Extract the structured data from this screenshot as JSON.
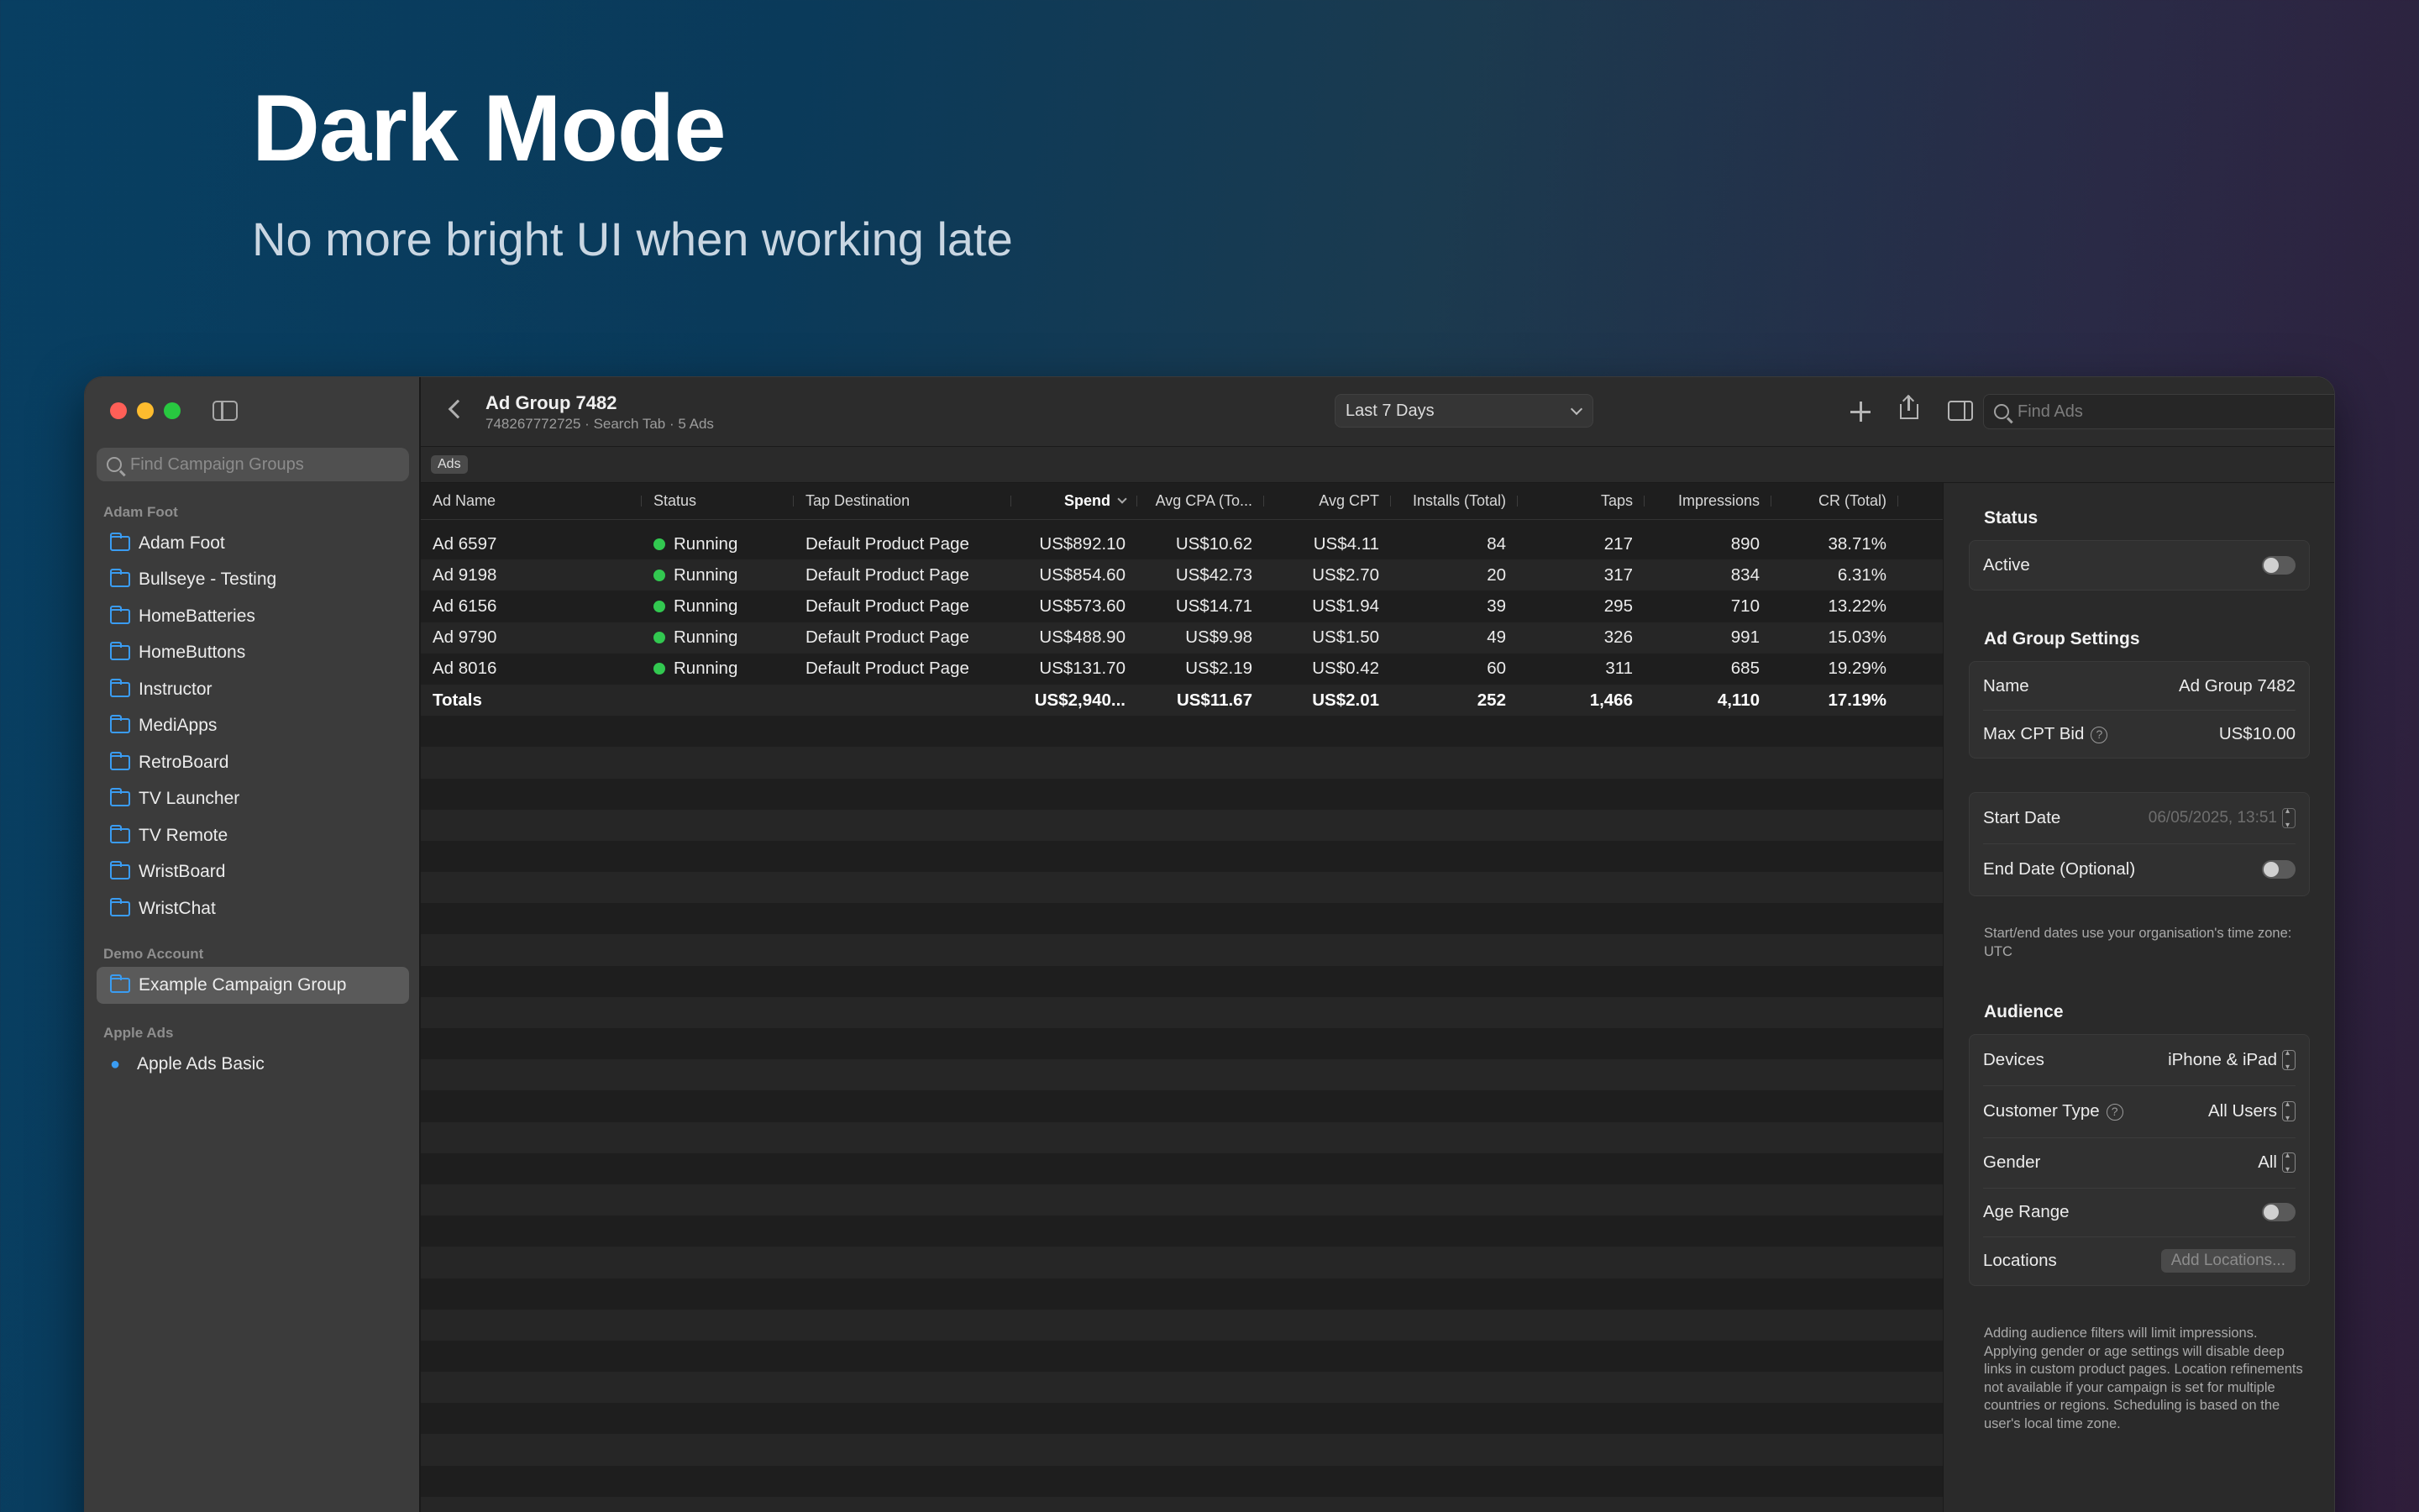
{
  "hero": {
    "title": "Dark Mode",
    "subtitle": "No more bright UI when working late"
  },
  "sidebar": {
    "search_placeholder": "Find Campaign Groups",
    "sections": [
      {
        "heading": "Adam Foot",
        "items": [
          "Adam Foot",
          "Bullseye - Testing",
          "HomeBatteries",
          "HomeButtons",
          "Instructor",
          "MediApps",
          "RetroBoard",
          "TV Launcher",
          "TV Remote",
          "WristBoard",
          "WristChat"
        ]
      },
      {
        "heading": "Demo Account",
        "items": [
          "Example Campaign Group"
        ]
      },
      {
        "heading": "Apple Ads",
        "items": [
          "Apple Ads Basic"
        ]
      }
    ]
  },
  "toolbar": {
    "title": "Ad Group 7482",
    "subtitle": "748267772725 · Search Tab · 5 Ads",
    "date_range": "Last 7 Days",
    "find_placeholder": "Find Ads",
    "tab_label": "Ads"
  },
  "table": {
    "columns": [
      "Ad Name",
      "Status",
      "Tap Destination",
      "Spend",
      "Avg CPA (To...",
      "Avg CPT",
      "Installs (Total)",
      "Taps",
      "Impressions",
      "CR (Total)"
    ],
    "rows": [
      [
        "Ad 6597",
        "Running",
        "Default Product Page",
        "US$892.10",
        "US$10.62",
        "US$4.11",
        "84",
        "217",
        "890",
        "38.71%"
      ],
      [
        "Ad 9198",
        "Running",
        "Default Product Page",
        "US$854.60",
        "US$42.73",
        "US$2.70",
        "20",
        "317",
        "834",
        "6.31%"
      ],
      [
        "Ad 6156",
        "Running",
        "Default Product Page",
        "US$573.60",
        "US$14.71",
        "US$1.94",
        "39",
        "295",
        "710",
        "13.22%"
      ],
      [
        "Ad 9790",
        "Running",
        "Default Product Page",
        "US$488.90",
        "US$9.98",
        "US$1.50",
        "49",
        "326",
        "991",
        "15.03%"
      ],
      [
        "Ad 8016",
        "Running",
        "Default Product Page",
        "US$131.70",
        "US$2.19",
        "US$0.42",
        "60",
        "311",
        "685",
        "19.29%"
      ]
    ],
    "totals": [
      "Totals",
      "",
      "",
      "US$2,940...",
      "US$11.67",
      "US$2.01",
      "252",
      "1,466",
      "4,110",
      "17.19%"
    ]
  },
  "inspector": {
    "status_heading": "Status",
    "active_label": "Active",
    "settings_heading": "Ad Group Settings",
    "name_label": "Name",
    "name_value": "Ad Group 7482",
    "max_cpt_label": "Max CPT Bid",
    "max_cpt_value": "US$10.00",
    "start_date_label": "Start Date",
    "start_date_value": "06/05/2025, 13:51",
    "end_date_label": "End Date (Optional)",
    "date_note": "Start/end dates use your organisation's time zone: UTC",
    "audience_heading": "Audience",
    "devices_label": "Devices",
    "devices_value": "iPhone & iPad",
    "customer_type_label": "Customer Type",
    "customer_type_value": "All Users",
    "gender_label": "Gender",
    "gender_value": "All",
    "age_range_label": "Age Range",
    "locations_label": "Locations",
    "add_locations_label": "Add Locations...",
    "audience_note": "Adding audience filters will limit impressions. Applying gender or age settings will disable deep links in custom product pages. Location refinements not available if your campaign is set for multiple countries or regions. Scheduling is based on the user's local time zone."
  },
  "colors": {
    "running": "#32c850",
    "accent": "#3a9cf2"
  }
}
